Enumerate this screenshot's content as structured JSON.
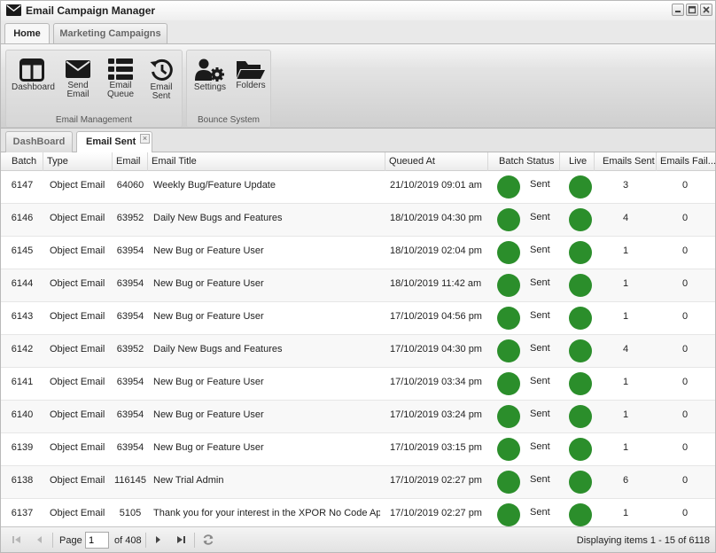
{
  "window": {
    "title": "Email Campaign Manager"
  },
  "ribbon": {
    "tabs": [
      {
        "label": "Home"
      },
      {
        "label": "Marketing Campaigns"
      }
    ],
    "groups": [
      {
        "label": "Email Management",
        "buttons": [
          {
            "line1": "Dashboard",
            "line2": "",
            "icon": "dashboard-icon"
          },
          {
            "line1": "Send",
            "line2": "Email",
            "icon": "envelope-icon"
          },
          {
            "line1": "Email",
            "line2": "Queue",
            "icon": "queue-icon"
          },
          {
            "line1": "Email",
            "line2": "Sent",
            "icon": "history-icon"
          }
        ]
      },
      {
        "label": "Bounce System",
        "buttons": [
          {
            "line1": "Settings",
            "line2": "",
            "icon": "users-gear-icon"
          },
          {
            "line1": "Folders",
            "line2": "",
            "icon": "folder-open-icon"
          }
        ]
      }
    ]
  },
  "doc_tabs": [
    {
      "label": "DashBoard"
    },
    {
      "label": "Email Sent"
    }
  ],
  "grid": {
    "columns": [
      "Batch",
      "Type",
      "Email",
      "Email Title",
      "Queued At",
      "Batch Status",
      "Live",
      "Emails Sent",
      "Emails Fail..."
    ],
    "status_color": "#2b8e2b",
    "rows": [
      {
        "batch": "6147",
        "type": "Object Email",
        "email": "64060",
        "title": "Weekly Bug/Feature Update",
        "queued": "21/10/2019 09:01 am",
        "status": "Sent",
        "sent": "3",
        "failed": "0"
      },
      {
        "batch": "6146",
        "type": "Object Email",
        "email": "63952",
        "title": "Daily New Bugs and Features",
        "queued": "18/10/2019 04:30 pm",
        "status": "Sent",
        "sent": "4",
        "failed": "0"
      },
      {
        "batch": "6145",
        "type": "Object Email",
        "email": "63954",
        "title": "New Bug or Feature User",
        "queued": "18/10/2019 02:04 pm",
        "status": "Sent",
        "sent": "1",
        "failed": "0"
      },
      {
        "batch": "6144",
        "type": "Object Email",
        "email": "63954",
        "title": "New Bug or Feature User",
        "queued": "18/10/2019 11:42 am",
        "status": "Sent",
        "sent": "1",
        "failed": "0"
      },
      {
        "batch": "6143",
        "type": "Object Email",
        "email": "63954",
        "title": "New Bug or Feature User",
        "queued": "17/10/2019 04:56 pm",
        "status": "Sent",
        "sent": "1",
        "failed": "0"
      },
      {
        "batch": "6142",
        "type": "Object Email",
        "email": "63952",
        "title": "Daily New Bugs and Features",
        "queued": "17/10/2019 04:30 pm",
        "status": "Sent",
        "sent": "4",
        "failed": "0"
      },
      {
        "batch": "6141",
        "type": "Object Email",
        "email": "63954",
        "title": "New Bug or Feature User",
        "queued": "17/10/2019 03:34 pm",
        "status": "Sent",
        "sent": "1",
        "failed": "0"
      },
      {
        "batch": "6140",
        "type": "Object Email",
        "email": "63954",
        "title": "New Bug or Feature User",
        "queued": "17/10/2019 03:24 pm",
        "status": "Sent",
        "sent": "1",
        "failed": "0"
      },
      {
        "batch": "6139",
        "type": "Object Email",
        "email": "63954",
        "title": "New Bug or Feature User",
        "queued": "17/10/2019 03:15 pm",
        "status": "Sent",
        "sent": "1",
        "failed": "0"
      },
      {
        "batch": "6138",
        "type": "Object Email",
        "email": "116145",
        "title": "New Trial Admin",
        "queued": "17/10/2019 02:27 pm",
        "status": "Sent",
        "sent": "6",
        "failed": "0"
      },
      {
        "batch": "6137",
        "type": "Object Email",
        "email": "5105",
        "title": "Thank you for your interest in the XPOR No Code Applic...",
        "queued": "17/10/2019 02:27 pm",
        "status": "Sent",
        "sent": "1",
        "failed": "0"
      }
    ]
  },
  "pager": {
    "page_label": "Page",
    "page_value": "1",
    "of_label": "of 408",
    "info": "Displaying items 1 - 15 of 6118"
  }
}
